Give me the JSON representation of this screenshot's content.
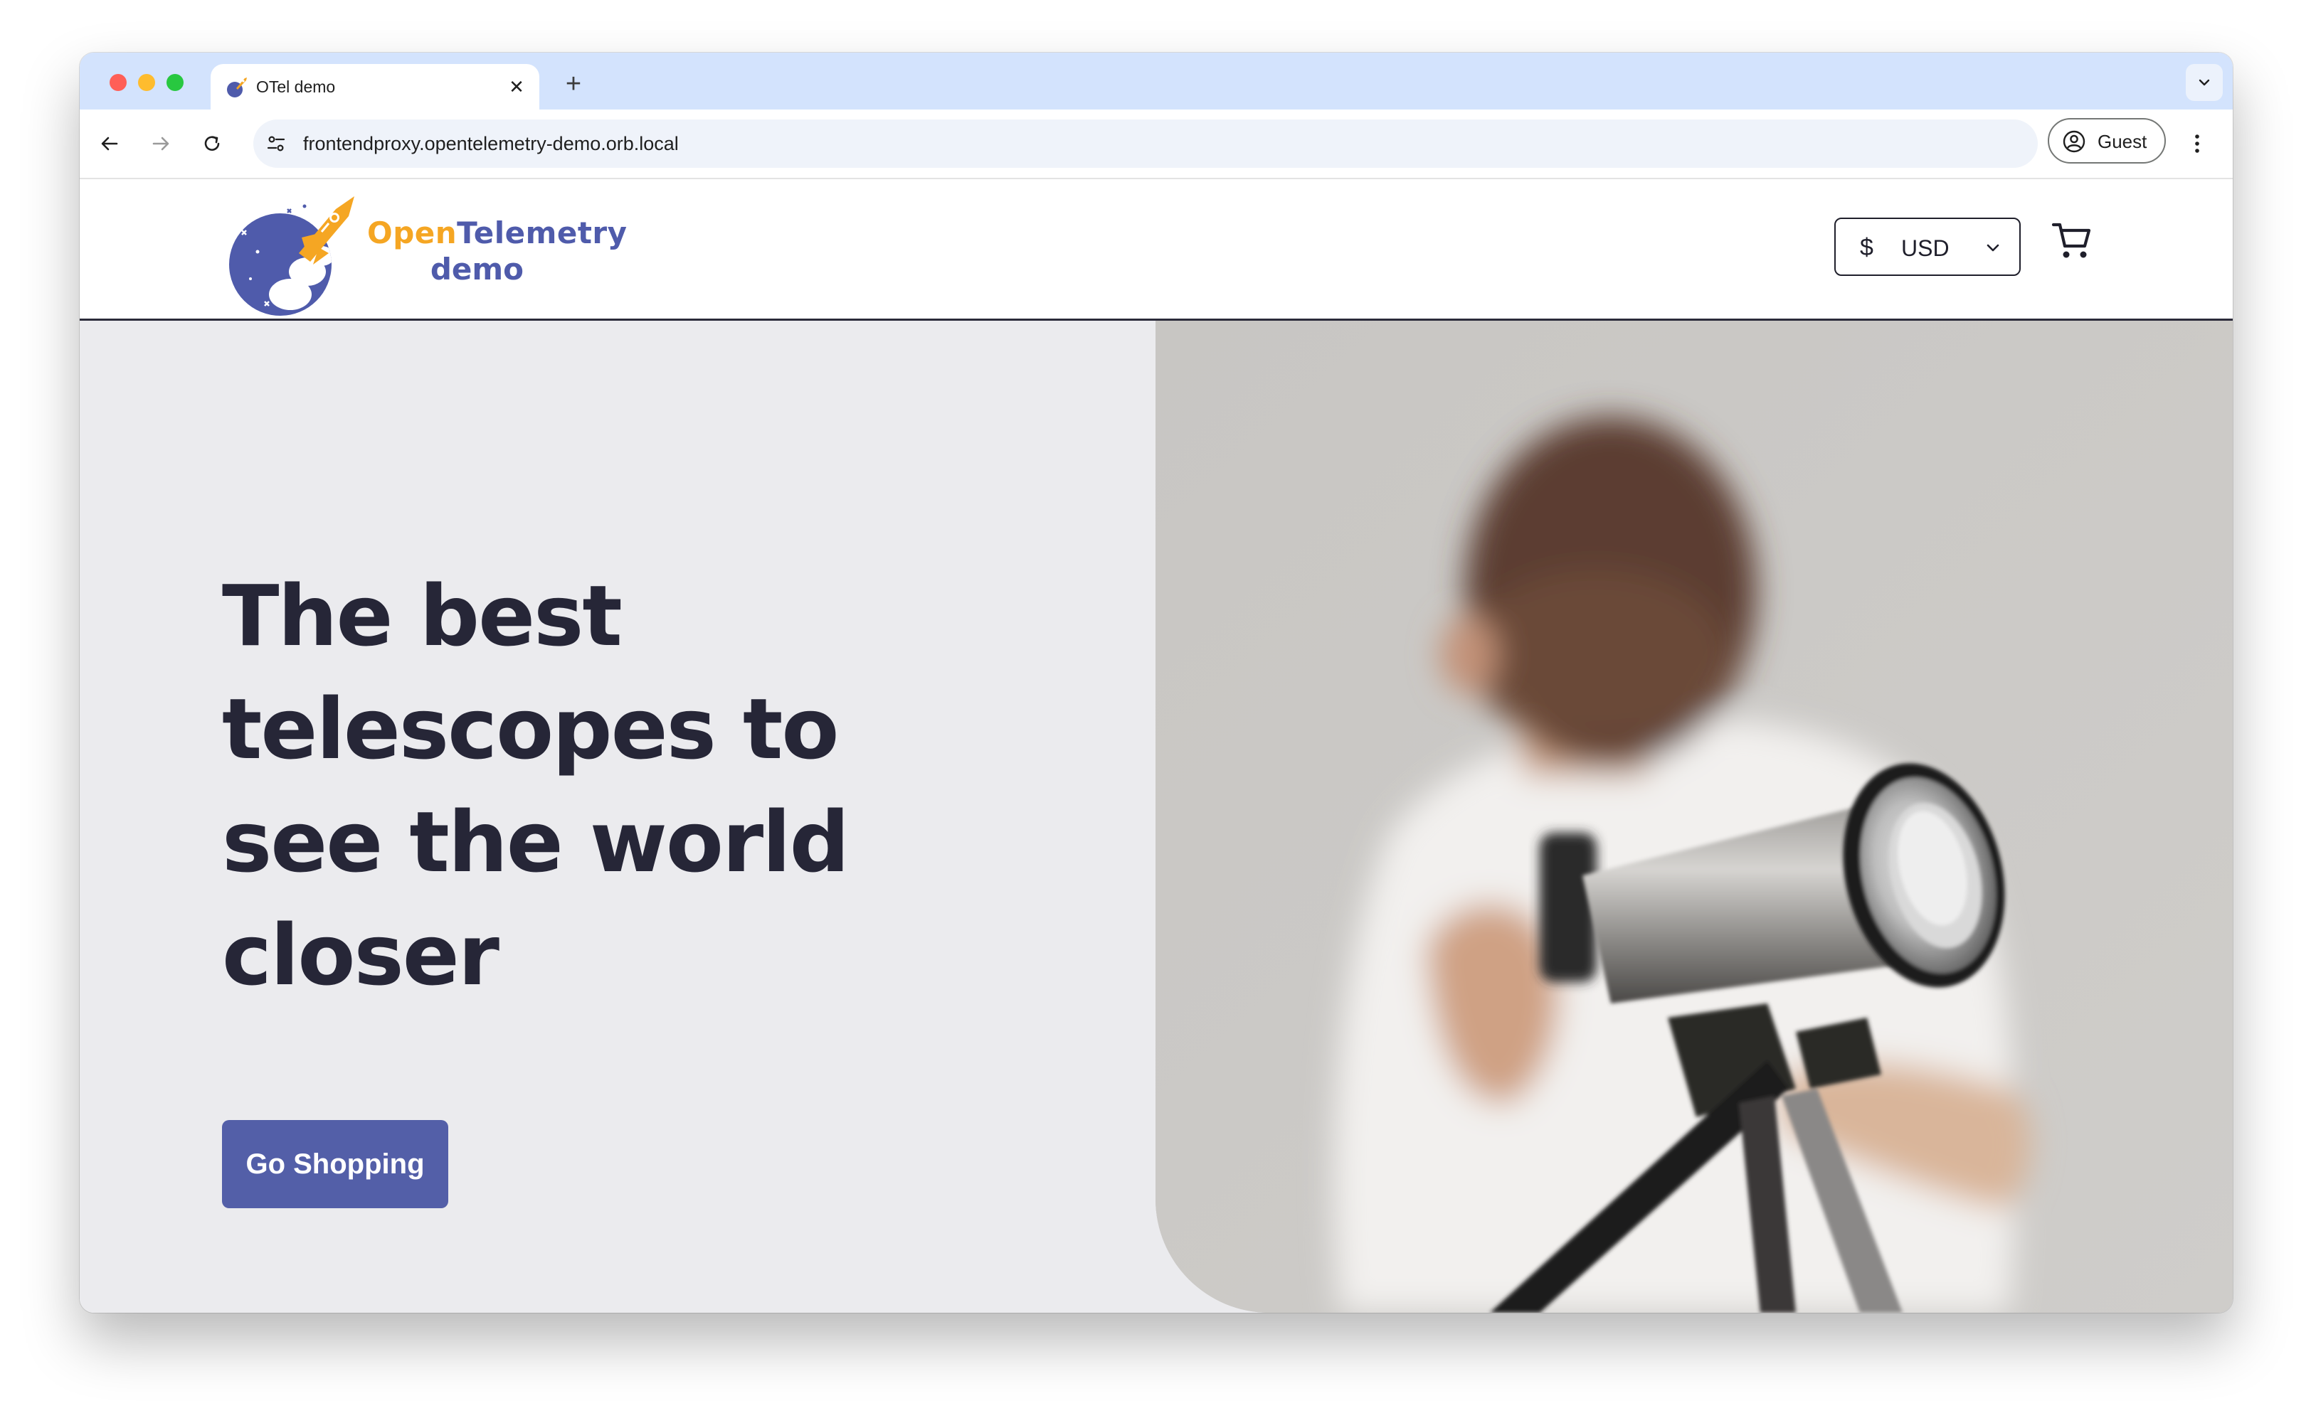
{
  "browser": {
    "tab_title": "OTel demo",
    "tab_close_icon": "close-icon",
    "new_tab_label": "+",
    "url": "frontendproxy.opentelemetry-demo.orb.local",
    "profile_label": "Guest"
  },
  "site": {
    "brand_open": "Open",
    "brand_telemetry": "Telemetry",
    "brand_demo": "demo",
    "currency_symbol": "$",
    "currency_code": "USD"
  },
  "hero": {
    "title": "The best telescopes to see the world closer",
    "button_label": "Go Shopping"
  },
  "colors": {
    "tabstrip": "#d3e3fd",
    "brand_orange": "#f5a623",
    "brand_blue": "#4f5bab",
    "hero_bg": "#ebebee",
    "hero_text": "#262637",
    "button_bg": "#535fa8"
  }
}
